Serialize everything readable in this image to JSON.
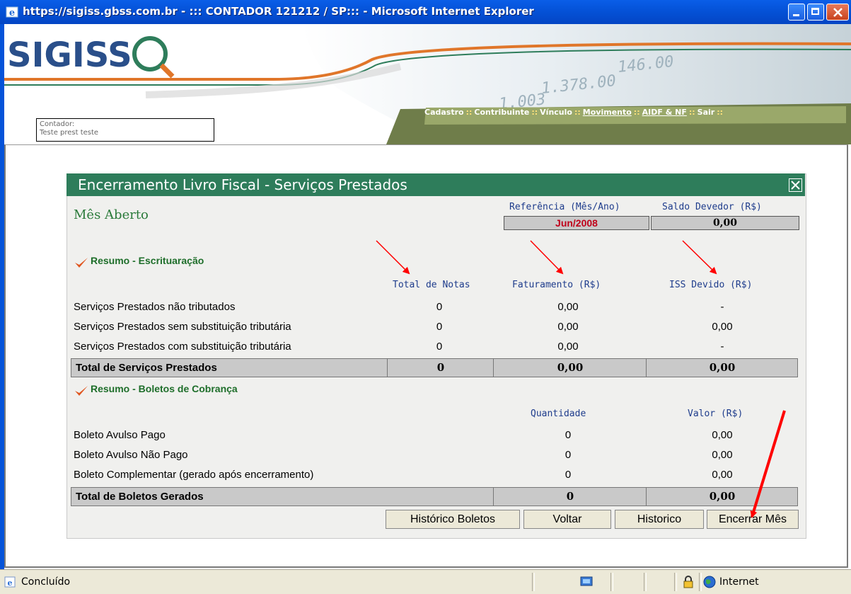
{
  "window": {
    "title": "https://sigiss.gbss.com.br - ::: CONTADOR 121212 / SP::: - Microsoft Internet Explorer",
    "buttons": {
      "minimize": "minimize-icon",
      "maximize": "maximize-icon",
      "close": "close-icon"
    }
  },
  "header": {
    "logo_text": "SIGISS",
    "contador_label": "Contador:",
    "contador_value": "Teste prest teste",
    "menu": [
      {
        "label": "Cadastro",
        "underline": false
      },
      {
        "label": "Contribuinte",
        "underline": false
      },
      {
        "label": "Vínculo",
        "underline": false
      },
      {
        "label": "Movimento",
        "underline": true
      },
      {
        "label": "AIDF & NF",
        "underline": true
      },
      {
        "label": "Sair",
        "underline": false
      }
    ],
    "menu_separator": "::",
    "background_numbers": [
      "146.00",
      "1.378.00",
      "1.003"
    ]
  },
  "panel": {
    "title": "Encerramento Livro Fiscal - Serviços Prestados",
    "status": "Mês Aberto",
    "referencia_label": "Referência (Mês/Ano)",
    "referencia_value": "Jun/2008",
    "saldo_label": "Saldo Devedor (R$)",
    "saldo_value": "0,00",
    "escrituracao": {
      "title": "Resumo - Escrituaração",
      "columns": [
        "Total de Notas",
        "Faturamento (R$)",
        "ISS Devido (R$)"
      ],
      "rows": [
        {
          "label": "Serviços Prestados não tributados",
          "notas": "0",
          "faturamento": "0,00",
          "iss": "-"
        },
        {
          "label": "Serviços Prestados sem substituição tributária",
          "notas": "0",
          "faturamento": "0,00",
          "iss": "0,00"
        },
        {
          "label": "Serviços Prestados com substituição tributária",
          "notas": "0",
          "faturamento": "0,00",
          "iss": "-"
        }
      ],
      "total": {
        "label": "Total de Serviços Prestados",
        "notas": "0",
        "faturamento": "0,00",
        "iss": "0,00"
      }
    },
    "boletos": {
      "title": "Resumo - Boletos de Cobrança",
      "columns": [
        "Quantidade",
        "Valor (R$)"
      ],
      "rows": [
        {
          "label": "Boleto Avulso Pago",
          "quantidade": "0",
          "valor": "0,00"
        },
        {
          "label": "Boleto Avulso Não Pago",
          "quantidade": "0",
          "valor": "0,00"
        },
        {
          "label": "Boleto Complementar (gerado após encerramento)",
          "quantidade": "0",
          "valor": "0,00"
        }
      ],
      "total": {
        "label": "Total de Boletos Gerados",
        "quantidade": "0",
        "valor": "0,00"
      }
    },
    "buttons": {
      "historico_boletos": "Histórico Boletos",
      "voltar": "Voltar",
      "historico": "Historico",
      "encerrar": "Encerrar Mês"
    }
  },
  "statusbar": {
    "status": "Concluído",
    "zone": "Internet"
  },
  "colors": {
    "title_blue": "#0553d9",
    "panel_header": "#2e7d5b",
    "accent_green": "#1e6e2a",
    "header_orange": "#e0762a",
    "menu_green": "#9aa86a",
    "referencia_red": "#c0001a",
    "annotation_red": "#ff0000"
  }
}
